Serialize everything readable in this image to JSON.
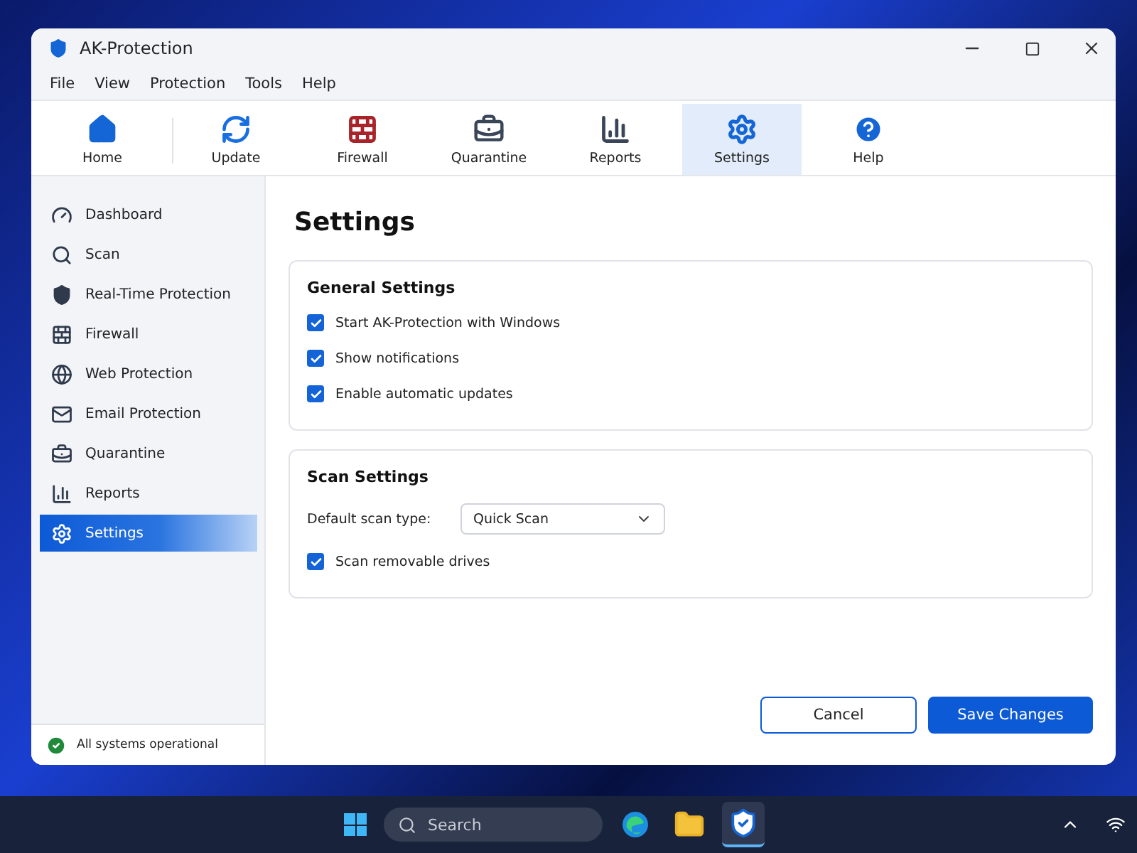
{
  "window": {
    "title": "AK-Protection"
  },
  "menu": [
    "File",
    "View",
    "Protection",
    "Tools",
    "Help"
  ],
  "toolbar": [
    {
      "label": "Home",
      "kind": "home",
      "selected": false
    },
    {
      "label": "Update",
      "kind": "update",
      "selected": false
    },
    {
      "label": "Firewall",
      "kind": "firewall",
      "selected": false
    },
    {
      "label": "Quarantine",
      "kind": "quarantine",
      "selected": false
    },
    {
      "label": "Reports",
      "kind": "reports",
      "selected": false
    },
    {
      "label": "Settings",
      "kind": "settings",
      "selected": true
    },
    {
      "label": "Help",
      "kind": "help",
      "selected": false
    }
  ],
  "sidebar": {
    "items": [
      {
        "label": "Dashboard",
        "kind": "dashboard",
        "selected": false
      },
      {
        "label": "Scan",
        "kind": "scan",
        "selected": false
      },
      {
        "label": "Real-Time Protection",
        "kind": "shield",
        "selected": false
      },
      {
        "label": "Firewall",
        "kind": "firewall",
        "selected": false
      },
      {
        "label": "Web Protection",
        "kind": "web",
        "selected": false
      },
      {
        "label": "Email Protection",
        "kind": "email",
        "selected": false
      },
      {
        "label": "Quarantine",
        "kind": "quarantine",
        "selected": false
      },
      {
        "label": "Reports",
        "kind": "reports",
        "selected": false
      },
      {
        "label": "Settings",
        "kind": "settings",
        "selected": true
      }
    ],
    "status": "All systems operational"
  },
  "page_title": "Settings",
  "sections": [
    {
      "title": "General Settings",
      "rows": [
        {
          "kind": "checkbox",
          "label": "Start AK-Protection with Windows",
          "checked": true
        },
        {
          "kind": "checkbox",
          "label": "Show notifications",
          "checked": true
        },
        {
          "kind": "checkbox",
          "label": "Enable automatic updates",
          "checked": true
        }
      ]
    },
    {
      "title": "Scan Settings",
      "rows": [
        {
          "kind": "select",
          "label": "Default scan type:",
          "value": "Quick Scan"
        },
        {
          "kind": "checkbox",
          "label": "Scan removable drives",
          "checked": true
        }
      ]
    }
  ],
  "buttons": [
    {
      "label": "Cancel",
      "kind": "secondary"
    },
    {
      "label": "Save Changes",
      "kind": "primary"
    }
  ],
  "taskbar": {
    "search": {
      "placeholder": "Search"
    },
    "apps": [
      {
        "kind": "edge",
        "selected": false
      },
      {
        "kind": "folder",
        "selected": false
      },
      {
        "kind": "shield",
        "selected": true
      }
    ]
  }
}
